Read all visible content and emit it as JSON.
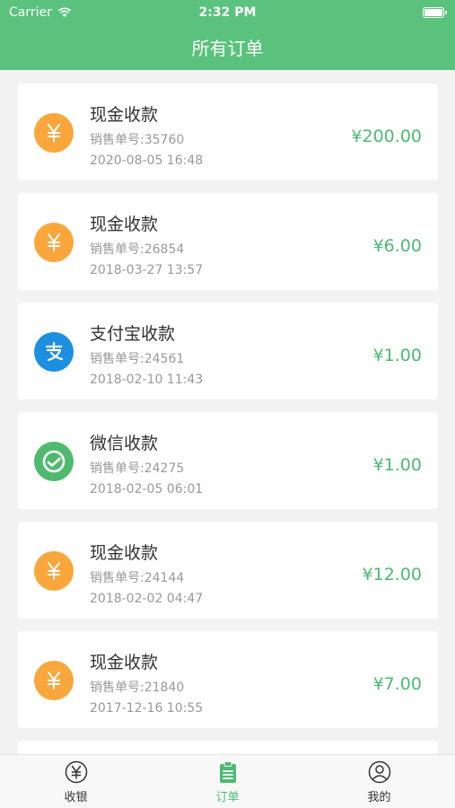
{
  "status_bar": {
    "carrier": "Carrier",
    "time": "2:32 PM"
  },
  "header": {
    "title": "所有订单"
  },
  "orders": [
    {
      "type": "cash",
      "title": "现金收款",
      "order_no": "销售单号:35760",
      "time": "2020-08-05 16:48",
      "amount": "¥200.00"
    },
    {
      "type": "cash",
      "title": "现金收款",
      "order_no": "销售单号:26854",
      "time": "2018-03-27 13:57",
      "amount": "¥6.00"
    },
    {
      "type": "alipay",
      "title": "支付宝收款",
      "order_no": "销售单号:24561",
      "time": "2018-02-10 11:43",
      "amount": "¥1.00"
    },
    {
      "type": "wechat",
      "title": "微信收款",
      "order_no": "销售单号:24275",
      "time": "2018-02-05 06:01",
      "amount": "¥1.00"
    },
    {
      "type": "cash",
      "title": "现金收款",
      "order_no": "销售单号:24144",
      "time": "2018-02-02 04:47",
      "amount": "¥12.00"
    },
    {
      "type": "cash",
      "title": "现金收款",
      "order_no": "销售单号:21840",
      "time": "2017-12-16 10:55",
      "amount": "¥7.00"
    }
  ],
  "icons": {
    "cash": "yen-icon",
    "alipay": "alipay-icon",
    "wechat": "wechat-pay-icon"
  },
  "tabbar": {
    "tabs": [
      {
        "label": "收银",
        "icon": "yen-circle-icon",
        "active": false
      },
      {
        "label": "订单",
        "icon": "clipboard-icon",
        "active": true
      },
      {
        "label": "我的",
        "icon": "user-icon",
        "active": false
      }
    ]
  },
  "colors": {
    "primary": "#5ac27c",
    "amount": "#4cbb72",
    "cash": "#f9a73c",
    "alipay": "#1c8fe0",
    "wechat": "#4fba6f"
  }
}
